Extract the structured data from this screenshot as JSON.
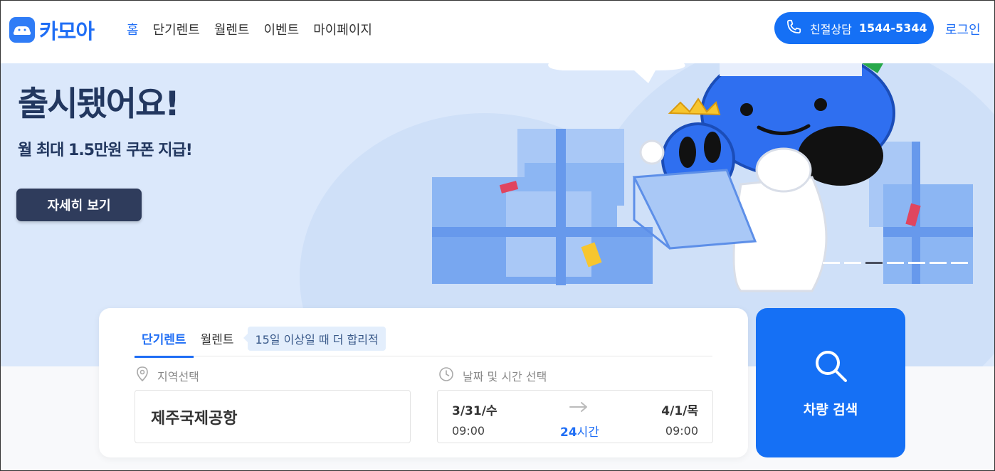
{
  "header": {
    "logo_text": "카모아",
    "nav": [
      "홈",
      "단기렌트",
      "월렌트",
      "이벤트",
      "마이페이지"
    ],
    "call_label": "친절상담",
    "call_number": "1544-5344",
    "login": "로그인"
  },
  "hero": {
    "title": "출시됐어요!",
    "subtitle": "월 최대 1.5만원 쿠폰 지급!",
    "button": "자세히 보기",
    "slide_count": 8,
    "active_slide": 3
  },
  "search": {
    "tabs": [
      "단기렌트",
      "월렌트"
    ],
    "badge": "15일 이상일 때 더 합리적",
    "location_label": "지역선택",
    "location_value": "제주국제공항",
    "date_label": "날짜 및 시간 선택",
    "start_date": "3/31/수",
    "start_time": "09:00",
    "end_date": "4/1/목",
    "end_time": "09:00",
    "duration_num": "24",
    "duration_unit": "시간",
    "button": "차량 검색"
  },
  "colors": {
    "brand": "#1570f5",
    "hero_bg": "#dbe8fb",
    "hero_text": "#22375f"
  }
}
